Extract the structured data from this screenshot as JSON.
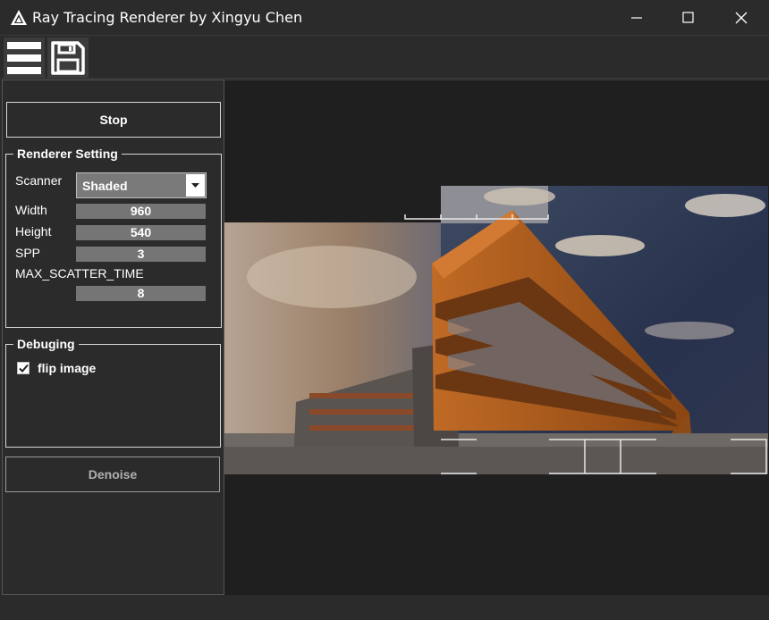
{
  "window": {
    "title": "Ray Tracing Renderer by Xingyu Chen",
    "controls": [
      "minimize-icon",
      "maximize-icon",
      "close-icon"
    ]
  },
  "toolbar": {
    "buttons": [
      "menu-icon",
      "save-icon"
    ]
  },
  "panel": {
    "stop_label": "Stop",
    "renderer": {
      "title": "Renderer Setting",
      "scanner_label": "Scanner",
      "scanner_value": "Shaded",
      "width_label": "Width",
      "width_value": "960",
      "height_label": "Height",
      "height_value": "540",
      "spp_label": "SPP",
      "spp_value": "3",
      "scatter_label": "MAX_SCATTER_TIME",
      "scatter_value": "8"
    },
    "debug": {
      "title": "Debuging",
      "flip_label": "flip image",
      "flip_checked": true
    },
    "denoise_label": "Denoise"
  },
  "colors": {
    "background": "#2b2b2b",
    "field": "#757575",
    "viewport": "#1f1f1f",
    "building": "#b5571a"
  }
}
